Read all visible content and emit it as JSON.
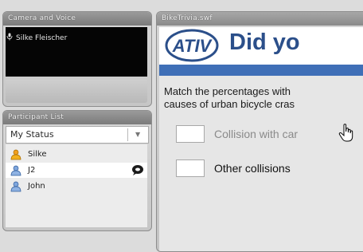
{
  "camera": {
    "title": "Camera and Voice",
    "speaker_name": "Silke Fleischer",
    "icons": {
      "speaker": "microphone-icon"
    }
  },
  "participants": {
    "title": "Participant List",
    "status_label": "My Status",
    "items": [
      {
        "name": "Silke",
        "icon": "host-user-icon",
        "selected": false
      },
      {
        "name": "J2",
        "icon": "user-icon",
        "selected": true,
        "chat": "chat-bubble-icon"
      },
      {
        "name": "John",
        "icon": "user-icon",
        "selected": false
      }
    ]
  },
  "content": {
    "title": "BikeTrivia.swf",
    "logo_text": "ATIV",
    "headline": "Did yo",
    "question_line1": "Match the percentages with",
    "question_line2": "causes of urban bicycle cras",
    "options": [
      {
        "label": "Collision with car",
        "state": "hover",
        "color": "#8a8a8a"
      },
      {
        "label": "Other collisions",
        "state": "normal",
        "color": "#111111"
      }
    ],
    "colors": {
      "headline": "#2b4f8a",
      "bar": "#3f6fb7"
    }
  }
}
